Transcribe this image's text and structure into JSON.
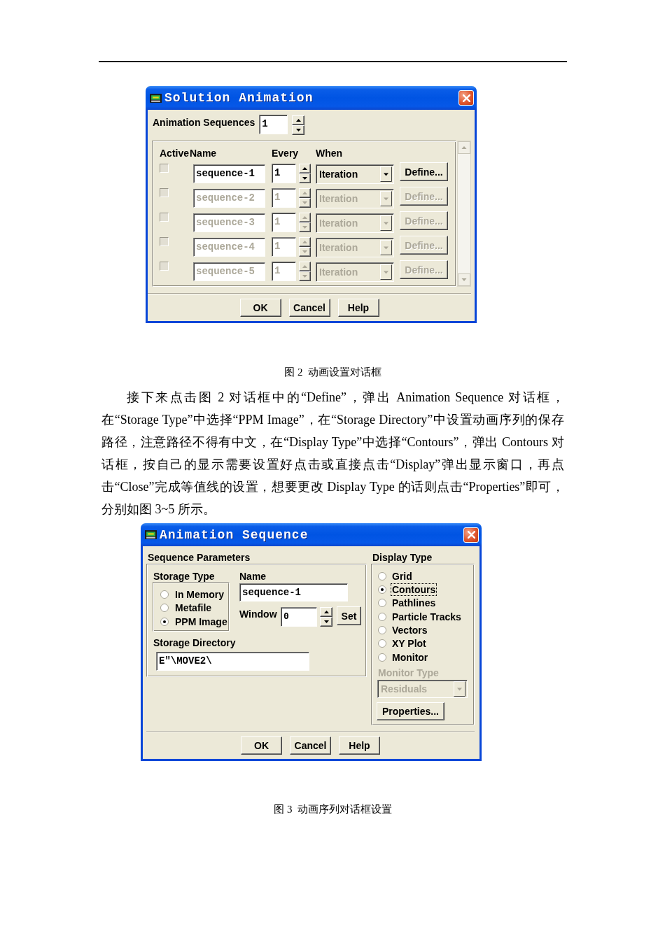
{
  "dialog_1": {
    "title": "Solution Animation",
    "sequences": {
      "label": "Animation Sequences",
      "value": "1"
    },
    "columns": [
      "Active",
      "Name",
      "Every",
      "When"
    ],
    "rows": [
      {
        "checked": false,
        "disabled": false,
        "name": "sequence-1",
        "every": "1",
        "when": "Iteration",
        "action": "Define..."
      },
      {
        "checked": false,
        "disabled": true,
        "name": "sequence-2",
        "every": "1",
        "when": "Iteration",
        "action": "Define..."
      },
      {
        "checked": false,
        "disabled": true,
        "name": "sequence-3",
        "every": "1",
        "when": "Iteration",
        "action": "Define..."
      },
      {
        "checked": false,
        "disabled": true,
        "name": "sequence-4",
        "every": "1",
        "when": "Iteration",
        "action": "Define..."
      },
      {
        "checked": false,
        "disabled": true,
        "name": "sequence-5",
        "every": "1",
        "when": "Iteration",
        "action": "Define..."
      }
    ],
    "buttons": [
      "OK",
      "Cancel",
      "Help"
    ]
  },
  "caption_1": "图 2  动画设置对话框",
  "paragraph": "接下来点击图 2 对话框中的“Define”，弹出 Animation Sequence 对话框，在“Storage Type”中选择“PPM Image”，在“Storage Directory”中设置动画序列的保存路径，注意路径不得有中文，在“Display Type”中选择“Contours”，弹出 Contours 对话框，按自己的显示需要设置好点击或直接点击“Display”弹出显示窗口，再点击“Close”完成等值线的设置，想要更改 Display Type 的话则点击“Properties”即可，分别如图 3~5 所示。",
  "dialog_2": {
    "title": "Animation Sequence",
    "parameters": {
      "label": "Sequence Parameters",
      "storage_type": {
        "label": "Storage Type",
        "options": [
          {
            "label": "In Memory",
            "selected": false
          },
          {
            "label": "Metafile",
            "selected": false
          },
          {
            "label": "PPM Image",
            "selected": true
          }
        ]
      },
      "name": {
        "label": "Name",
        "value": "sequence-1"
      },
      "window": {
        "label": "Window",
        "value": "0",
        "button": "Set"
      },
      "storage_directory": {
        "label": "Storage Directory",
        "value": "E\"\\MOVE2\\"
      }
    },
    "display_type": {
      "label": "Display Type",
      "options": [
        {
          "label": "Grid",
          "selected": false,
          "focused": false
        },
        {
          "label": "Contours",
          "selected": true,
          "focused": true
        },
        {
          "label": "Pathlines",
          "selected": false,
          "focused": false
        },
        {
          "label": "Particle Tracks",
          "selected": false,
          "focused": false
        },
        {
          "label": "Vectors",
          "selected": false,
          "focused": false
        },
        {
          "label": "XY Plot",
          "selected": false,
          "focused": false
        },
        {
          "label": "Monitor",
          "selected": false,
          "focused": false
        }
      ],
      "monitor_type": {
        "label": "Monitor Type",
        "value": "Residuals",
        "disabled": true
      },
      "properties_button": "Properties..."
    },
    "buttons": [
      "OK",
      "Cancel",
      "Help"
    ]
  },
  "caption_2": "图 3  动画序列对话框设置"
}
